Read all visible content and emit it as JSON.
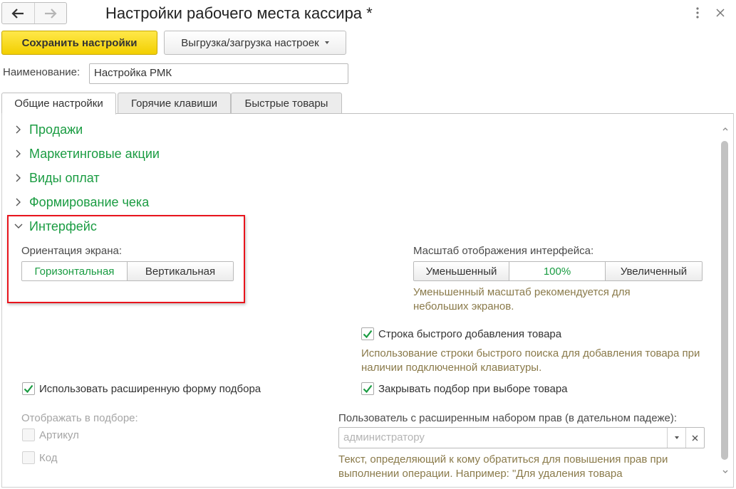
{
  "window": {
    "title": "Настройки рабочего места кассира *",
    "back_icon": "arrow-left-icon",
    "forward_icon": "arrow-right-icon"
  },
  "toolbar": {
    "save_label": "Сохранить настройки",
    "export_label": "Выгрузка/загрузка настроек"
  },
  "name_field": {
    "label": "Наименование:",
    "value": "Настройка РМК"
  },
  "tabs": [
    {
      "label": "Общие настройки",
      "active": true
    },
    {
      "label": "Горячие клавиши",
      "active": false
    },
    {
      "label": "Быстрые товары",
      "active": false
    }
  ],
  "groups": [
    {
      "label": "Продажи",
      "expanded": false
    },
    {
      "label": "Маркетинговые акции",
      "expanded": false
    },
    {
      "label": "Виды оплат",
      "expanded": false
    },
    {
      "label": "Формирование чека",
      "expanded": false
    },
    {
      "label": "Интерфейс",
      "expanded": true
    }
  ],
  "interface": {
    "orientation": {
      "label": "Ориентация экрана:",
      "options": [
        "Горизонтальная",
        "Вертикальная"
      ],
      "selected": "Горизонтальная"
    },
    "scale": {
      "label": "Масштаб отображения интерфейса:",
      "options": [
        "Уменьшенный",
        "100%",
        "Увеличенный"
      ],
      "selected": "100%",
      "hint": "Уменьшенный масштаб рекомендуется для небольших экранов."
    },
    "quick_add": {
      "label": "Строка быстрого добавления товара",
      "checked": true,
      "hint": "Использование строки быстрого поиска для добавления товара при наличии подключенной клавиатуры."
    },
    "extended_form": {
      "label": "Использовать расширенную форму подбора",
      "checked": true
    },
    "close_on_select": {
      "label": "Закрывать подбор при выборе товара",
      "checked": true
    },
    "show_in_selection": {
      "label": "Отображать в подборе:",
      "options": [
        {
          "label": "Артикул",
          "checked": false,
          "disabled": true
        },
        {
          "label": "Код",
          "checked": false,
          "disabled": true
        }
      ]
    },
    "privileged_user": {
      "label": "Пользователь с расширенным набором прав (в дательном падеже):",
      "placeholder": "администратору",
      "hint": "Текст, определяющий к кому обратиться для повышения прав при выполнении операции. Например: \"Для удаления товара"
    }
  },
  "colors": {
    "accent_green": "#1a9c42",
    "save_yellow": "#f5d90a",
    "highlight_red": "#e8141c",
    "hint_brown": "#8a7a4a"
  }
}
